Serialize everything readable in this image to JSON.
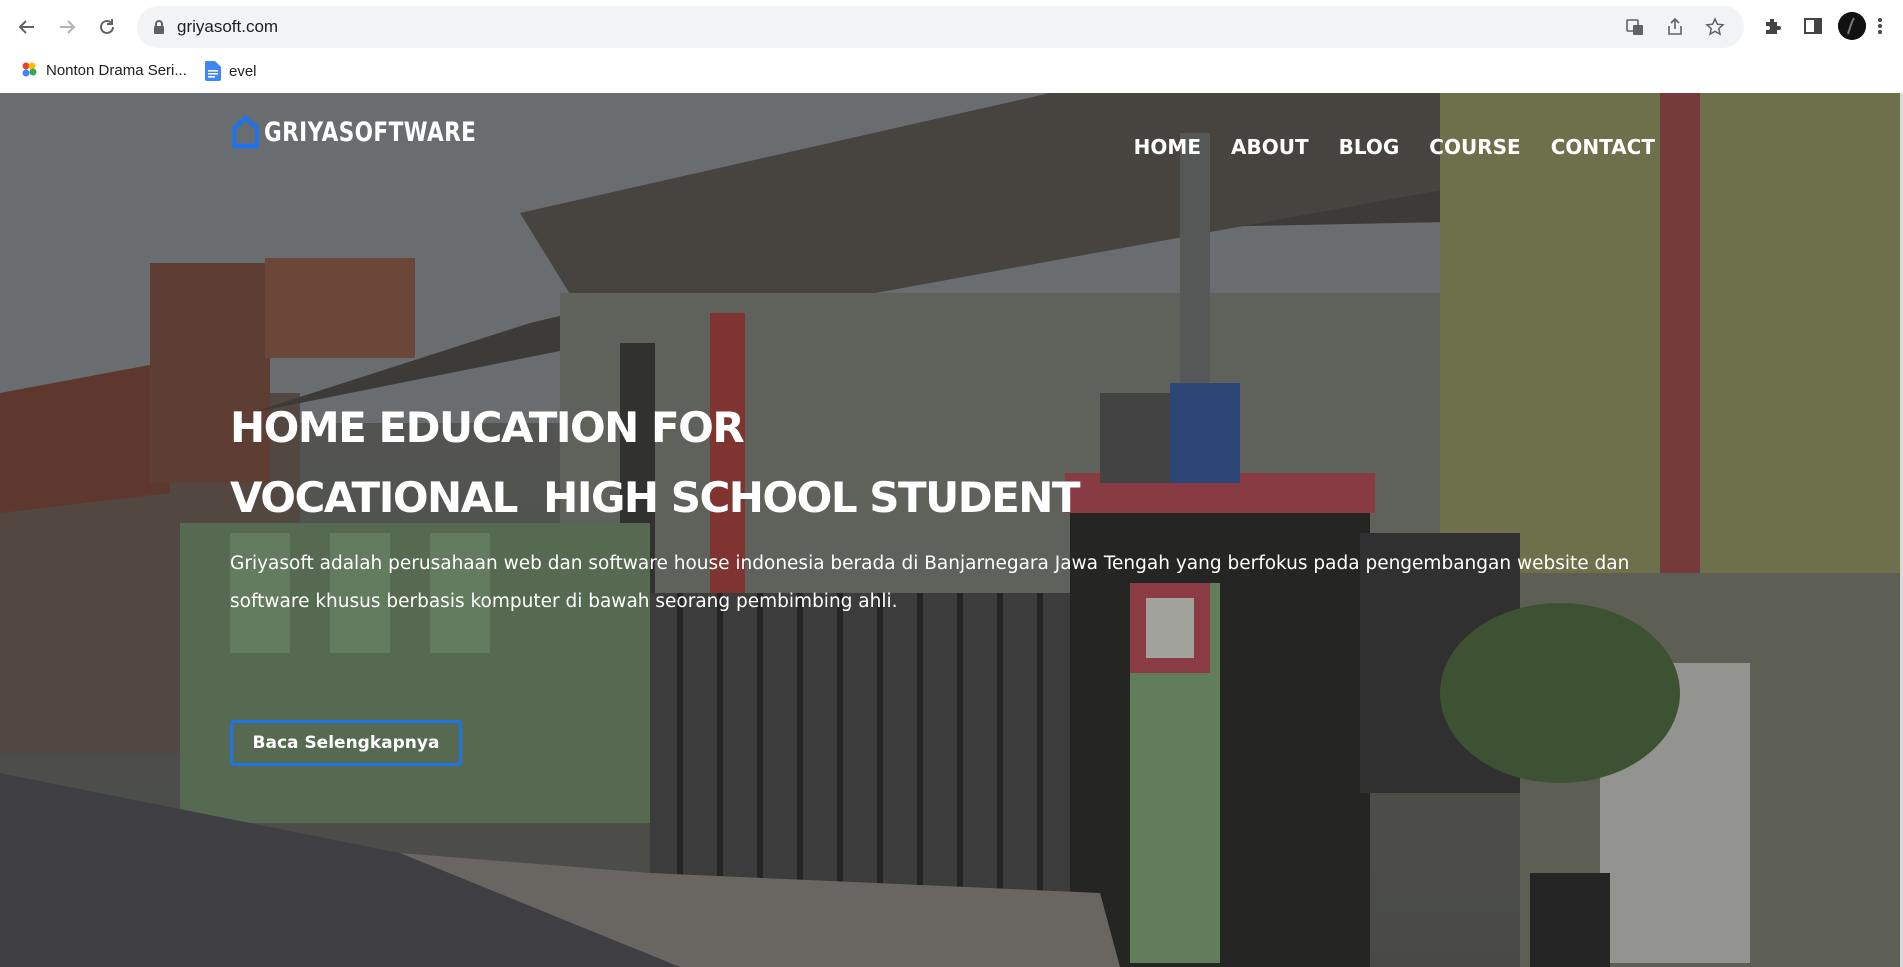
{
  "browser": {
    "url": "griyasoft.com",
    "bookmarks": [
      {
        "label": "Nonton Drama Seri..."
      },
      {
        "label": "evel"
      }
    ]
  },
  "site": {
    "logo_text": "GRIYASOFTWARE",
    "brand_color": "#1e73e8",
    "nav": [
      {
        "label": "HOME"
      },
      {
        "label": "ABOUT"
      },
      {
        "label": "BLOG"
      },
      {
        "label": "COURSE"
      },
      {
        "label": "CONTACT"
      }
    ]
  },
  "hero": {
    "headline_line1": "HOME EDUCATION FOR",
    "headline_line2": "VOCATIONAL  HIGH SCHOOL STUDENT",
    "description": "Griyasoft adalah perusahaan web dan software house indonesia berada di Banjarnegara Jawa Tengah yang berfokus pada pengembangan website dan software khusus berbasis komputer di bawah seorang pembimbing ahli.",
    "cta_label": "Baca Selengkapnya"
  }
}
